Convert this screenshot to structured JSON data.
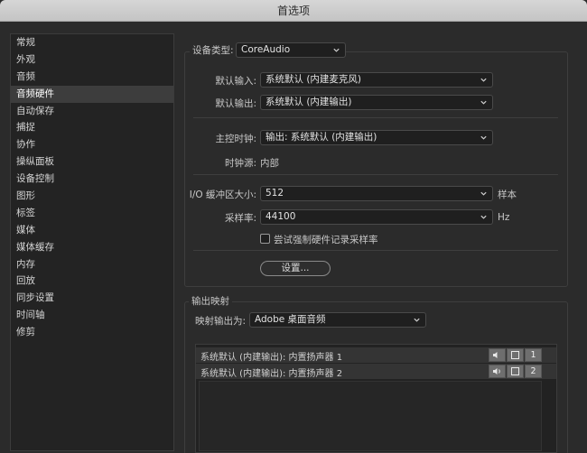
{
  "window": {
    "title": "首选项"
  },
  "sidebar": {
    "items": [
      {
        "label": "常规"
      },
      {
        "label": "外观"
      },
      {
        "label": "音频"
      },
      {
        "label": "音频硬件"
      },
      {
        "label": "自动保存"
      },
      {
        "label": "捕捉"
      },
      {
        "label": "协作"
      },
      {
        "label": "操纵面板"
      },
      {
        "label": "设备控制"
      },
      {
        "label": "图形"
      },
      {
        "label": "标签"
      },
      {
        "label": "媒体"
      },
      {
        "label": "媒体缓存"
      },
      {
        "label": "内存"
      },
      {
        "label": "回放"
      },
      {
        "label": "同步设置"
      },
      {
        "label": "时间轴"
      },
      {
        "label": "修剪"
      }
    ],
    "selected": "音频硬件"
  },
  "device": {
    "type_label": "设备类型:",
    "type_value": "CoreAudio",
    "default_input_label": "默认输入:",
    "default_input_value": "系统默认 (内建麦克风)",
    "default_output_label": "默认输出:",
    "default_output_value": "系统默认 (内建输出)",
    "master_clock_label": "主控时钟:",
    "master_clock_value": "输出: 系统默认 (内建输出)",
    "clock_source_label": "时钟源:",
    "clock_source_value": "内部",
    "buffer_label": "I/O 缓冲区大小:",
    "buffer_value": "512",
    "buffer_unit": "样本",
    "sample_rate_label": "采样率:",
    "sample_rate_value": "44100",
    "sample_rate_unit": "Hz",
    "force_checkbox_label": "尝试强制硬件记录采样率",
    "force_checkbox_checked": false,
    "settings_button": "设置..."
  },
  "output_mapping": {
    "title": "输出映射",
    "map_to_label": "映射输出为:",
    "map_to_value": "Adobe 桌面音频",
    "rows": [
      {
        "label": "系统默认 (内建输出): 内置扬声器 1",
        "channel": "1"
      },
      {
        "label": "系统默认 (内建输出): 内置扬声器 2",
        "channel": "2"
      }
    ]
  },
  "colors": {
    "background": "#2b2b2b",
    "selection": "#3d3d3d",
    "titlebar": "#cdcdcd"
  }
}
